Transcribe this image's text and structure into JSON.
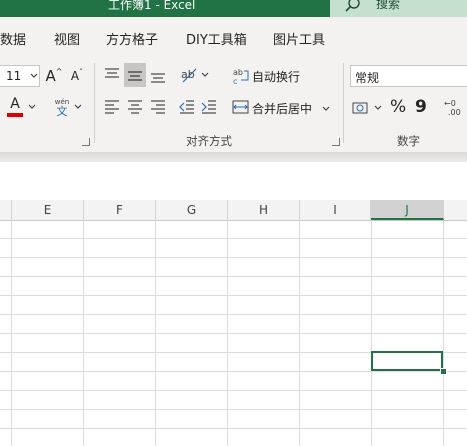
{
  "window": {
    "title": "工作簿1  -  Excel",
    "search_placeholder": "搜索"
  },
  "menu": {
    "tabs": [
      "数据",
      "视图",
      "方方格子",
      "DIY工具箱",
      "图片工具"
    ]
  },
  "ribbon": {
    "font_size": "11",
    "grow_font_label": "A",
    "shrink_font_label": "A",
    "font_color_label": "A",
    "phonetic_label": "wén",
    "phonetic_sub": "文",
    "wrap_text_label": "自动换行",
    "merge_center_label": "合并后居中",
    "alignment_group_label": "对齐方式",
    "number_format_value": "常规",
    "percent_label": "%",
    "comma_label": "9",
    "number_group_label": "数字",
    "accent_color": "#217346",
    "font_color_bar": "#e00000"
  },
  "sheet": {
    "columns": [
      "E",
      "F",
      "G",
      "H",
      "I",
      "J"
    ],
    "selected_column": "J"
  }
}
